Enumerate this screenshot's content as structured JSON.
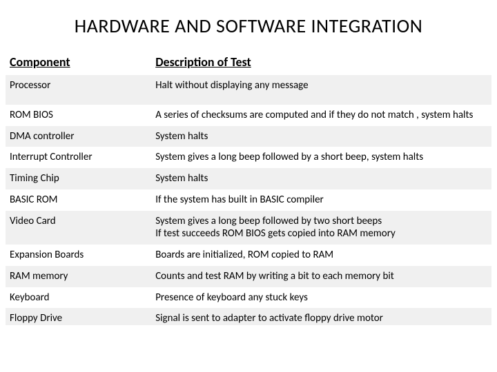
{
  "title": "HARDWARE AND SOFTWARE INTEGRATION",
  "headers": {
    "component": "Component",
    "description": "Description of Test"
  },
  "rows": [
    {
      "component": "Processor",
      "description": "Halt without displaying any message"
    },
    {
      "component": "ROM BIOS",
      "description": "A series of checksums are computed  and if they do not match , system halts"
    },
    {
      "component": "DMA controller",
      "description": "System halts"
    },
    {
      "component": "Interrupt Controller",
      "description": "System gives a long beep followed by a short beep, system halts"
    },
    {
      "component": "Timing Chip",
      "description": "System halts"
    },
    {
      "component": "BASIC ROM",
      "description": "If the system has built in BASIC compiler"
    },
    {
      "component": "Video Card",
      "description": "System gives a long beep followed by two short beeps\nIf test succeeds ROM BIOS gets copied into RAM memory"
    },
    {
      "component": "Expansion Boards",
      "description": "Boards are initialized, ROM copied to RAM"
    },
    {
      "component": "RAM memory",
      "description": "Counts and test RAM by writing a bit to each memory bit"
    },
    {
      "component": "Keyboard",
      "description": "Presence of keyboard any stuck keys"
    },
    {
      "component": "Floppy Drive",
      "description": "Signal is sent to adapter to activate floppy drive motor"
    }
  ]
}
